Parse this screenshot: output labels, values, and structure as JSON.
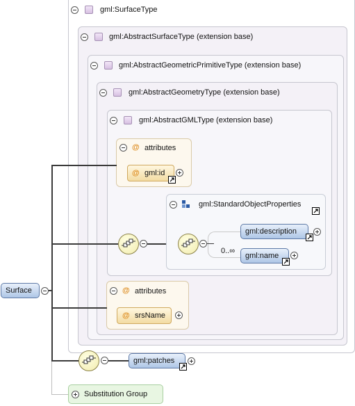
{
  "root": {
    "label": "gml:SurfaceType",
    "levels": [
      {
        "label": "gml:AbstractSurfaceType (extension base)"
      },
      {
        "label": "gml:AbstractGeometricPrimitiveType (extension base)"
      },
      {
        "label": "gml:AbstractGeometryType (extension base)"
      },
      {
        "label": "gml:AbstractGMLType (extension base)"
      }
    ]
  },
  "gml_attributes": {
    "title": "attributes",
    "items": [
      "gml:id"
    ]
  },
  "standard_props": {
    "label": "gml:StandardObjectProperties",
    "items": [
      "gml:description",
      "gml:name"
    ],
    "cardinality": "0..∞"
  },
  "geometry_attributes": {
    "title": "attributes",
    "items": [
      "srsName"
    ]
  },
  "surface": {
    "label": "Surface"
  },
  "patches": {
    "label": "gml:patches"
  },
  "substitution": {
    "label": "Substitution Group"
  },
  "icons": [
    "type-icon",
    "attribute-icon",
    "sequence-icon",
    "group-icon",
    "link-icon",
    "expand-icon",
    "collapse-icon"
  ],
  "colors": {
    "element_fill": "#aec6e6",
    "attribute_fill": "#f3dca3",
    "sequence_fill": "#f2ecaf",
    "substitution_fill": "#e8f6e2"
  }
}
